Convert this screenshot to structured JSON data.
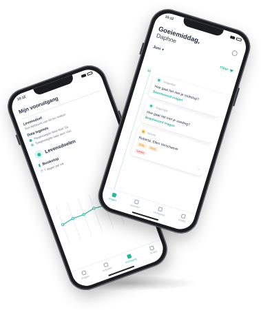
{
  "colors": {
    "accent": "#2bb5a0",
    "warning": "#f59e0b",
    "danger": "#dc2626"
  },
  "back_phone": {
    "time": "10:12",
    "title": "Mijn vooruitgang",
    "goal_label": "Levensdoel",
    "goal_text": "Een fietstocht van 60 km maken",
    "legend_title": "Data legends",
    "legend": [
      {
        "text": "Toegevoegde data door Sa",
        "color": "#2bb5a0"
      },
      {
        "text": "Toegevoegde data door Uzo",
        "color": "#7dd3c7"
      }
    ],
    "section_title": "Levensdoelen",
    "metric_title": "Bookstop",
    "metric_sub": "7 dagen per wk",
    "chart_data": {
      "type": "line",
      "title": "",
      "xlabel": "",
      "ylabel": "",
      "x": [
        1,
        2,
        3,
        4,
        5,
        6,
        7,
        8
      ],
      "series": [
        {
          "values": [
            5.2,
            5.8,
            5.8,
            6.4,
            6.1,
            5.1,
            4.2,
            3.6
          ]
        }
      ],
      "ylim": [
        0,
        10
      ],
      "grid": true,
      "color": "#2bb5a0"
    },
    "tabs": [
      {
        "label": "Vragen",
        "active": false
      },
      {
        "label": "Activiteit",
        "active": false
      },
      {
        "label": "Voortgang",
        "active": true
      },
      {
        "label": "Profiel",
        "active": false
      }
    ]
  },
  "front_phone": {
    "time": "10:12",
    "greeting": "Goeiemiddag,",
    "name": "Daphne",
    "month": "Juni",
    "filter_label": "Filter",
    "timeline_day": "10",
    "cards": [
      {
        "type": "Vragenlijst",
        "icon": "chat-icon",
        "question": "Hoe gaat het met je rookstop?",
        "link": "Beantwoord vragen"
      },
      {
        "type": "Vragenlijst",
        "icon": "chat-icon",
        "question": "Hoe gaat het met je voeding?",
        "link": "Beantwoord vragen"
      },
      {
        "type": "Bericht",
        "icon": "message-icon",
        "name": "Roberta, Ellen Verschaeve",
        "badges": [
          "Zorg",
          "Zorg"
        ],
        "status": "Lezen"
      }
    ],
    "tabs": [
      {
        "label": "Vragen",
        "active": true
      },
      {
        "label": "Activiteit",
        "active": false
      },
      {
        "label": "Voortgang",
        "active": false
      },
      {
        "label": "Profiel",
        "active": false
      }
    ]
  }
}
